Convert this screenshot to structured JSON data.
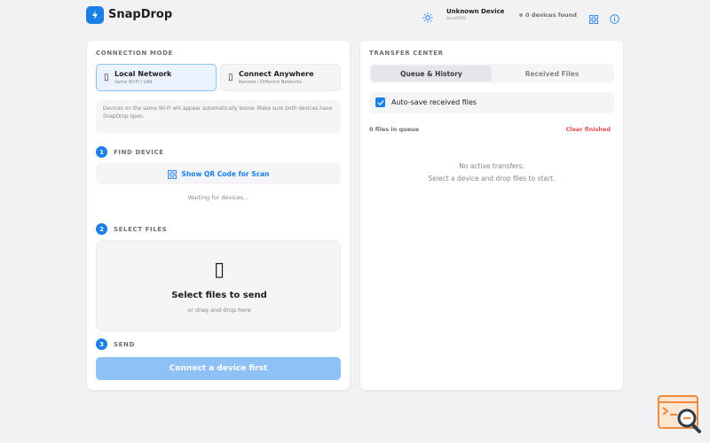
{
  "app": {
    "name": "SnapDrop"
  },
  "header": {
    "device_name": "Unknown Device",
    "device_sub": "NoveDROB",
    "devices_found": "0 devices found",
    "icons": [
      "lightning-icon",
      "sun-icon",
      "grid-icon",
      "info-icon"
    ]
  },
  "connection": {
    "title": "CONNECTION MODE",
    "modes": [
      {
        "title": "Local Network",
        "subtitle": "Same Wi-Fi / LAN",
        "icon": "▯",
        "active": true
      },
      {
        "title": "Connect Anywhere",
        "subtitle": "Remote / Different Networks",
        "icon": "▯",
        "active": false
      }
    ],
    "hint": "Devices on the same Wi-Fi will appear automatically below. Make sure both devices have SnapDrop open."
  },
  "steps": [
    {
      "num": "1",
      "title": "FIND DEVICE"
    },
    {
      "num": "2",
      "title": "SELECT FILES"
    },
    {
      "num": "3",
      "title": "SEND"
    }
  ],
  "find": {
    "qr_label": "Show QR Code for Scan",
    "waiting": "Waiting for devices..."
  },
  "files": {
    "icon": "▯",
    "title": "Select files to send",
    "subtitle": "or drag and drop here"
  },
  "send": {
    "label": "Connect a device first"
  },
  "transfer": {
    "title": "TRANSFER CENTER",
    "tabs": [
      {
        "label": "Queue & History",
        "active": true
      },
      {
        "label": "Received Files",
        "active": false
      }
    ],
    "autosave_label": "Auto-save received files",
    "autosave_checked": true,
    "queue_count": "0 files in queue",
    "clear_label": "Clear finished",
    "empty_line1": "No active transfers.",
    "empty_line2": "Select a device and drop files to start."
  },
  "colors": {
    "accent": "#1a7fe6",
    "danger": "#e5484d",
    "background": "#f2f2f5",
    "send_disabled": "#8ec2f7"
  }
}
